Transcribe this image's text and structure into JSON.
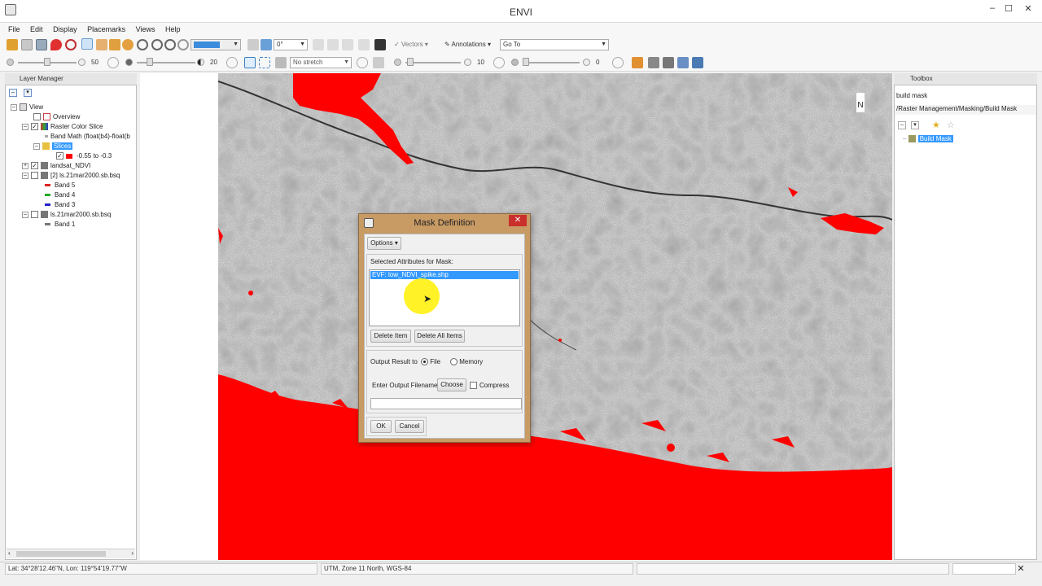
{
  "window": {
    "title": "ENVI",
    "min": "–",
    "max": "☐",
    "close": "✕"
  },
  "menu": [
    "File",
    "Edit",
    "Display",
    "Placemarks",
    "Views",
    "Help"
  ],
  "toolbar1": {
    "rotation": "0°",
    "vectors_label": "Vectors",
    "annotations_label": "Annotations",
    "goto_value": "Go To"
  },
  "toolbar2": {
    "brightness": "50",
    "contrast": "20",
    "stretch_value": "No stretch",
    "sharpen": "10",
    "transparency": "0"
  },
  "layer_manager": {
    "title": "Layer Manager",
    "tree": [
      {
        "label": "View"
      },
      {
        "label": "Overview"
      },
      {
        "label": "Raster Color Slice"
      },
      {
        "label": "Band Math (float(b4)-float(b"
      },
      {
        "label": "Slices"
      },
      {
        "label": "-0.55 to -0.3"
      },
      {
        "label": "landsat_NDVI"
      },
      {
        "label": "[2] ls.21mar2000.sb.bsq"
      },
      {
        "label": "Band 5"
      },
      {
        "label": "Band 4"
      },
      {
        "label": "Band 3"
      },
      {
        "label": "ls.21mar2000.sb.bsq"
      },
      {
        "label": "Band 1"
      }
    ]
  },
  "toolbox": {
    "title": "Toolbox",
    "search_value": "build mask",
    "path": "/Raster Management/Masking/Build Mask",
    "result": "Build Mask"
  },
  "north_label": "N",
  "dialog": {
    "title": "Mask Definition",
    "options_label": "Options",
    "selected_label": "Selected Attributes for Mask:",
    "selected_item": "EVF: low_NDVI_spike.shp",
    "delete_item": "Delete Item",
    "delete_all": "Delete All Items",
    "output_label": "Output Result to",
    "file_label": "File",
    "memory_label": "Memory",
    "filename_label": "Enter Output Filename",
    "choose_label": "Choose",
    "compress_label": "Compress",
    "filename_value": "",
    "ok_label": "OK",
    "cancel_label": "Cancel"
  },
  "status": {
    "latlon": "Lat: 34°28'12.46\"N, Lon: 119°54'19.77\"W",
    "projection": "UTM, Zone 11 North, WGS-84"
  },
  "colors": {
    "mask_red": "#ff0000",
    "selection": "#3399ff",
    "dialog_frame": "#c89a64"
  }
}
